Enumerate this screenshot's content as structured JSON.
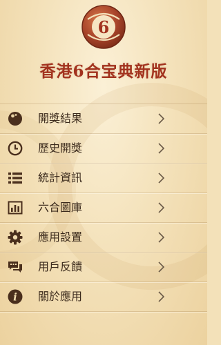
{
  "app": {
    "logo_icon": "lottery-ball-6-logo",
    "title": "香港6合宝典新版"
  },
  "colors": {
    "title": "#a2321e",
    "icon": "#4a2f1d",
    "background": "#f3e1b9"
  },
  "menu": {
    "items": [
      {
        "label": "開獎結果",
        "icon": "ball-icon"
      },
      {
        "label": "歷史開獎",
        "icon": "clock-icon"
      },
      {
        "label": "統計資訊",
        "icon": "list-icon"
      },
      {
        "label": "六合圖庫",
        "icon": "chart-icon"
      },
      {
        "label": "應用設置",
        "icon": "gear-icon"
      },
      {
        "label": "用戶反饋",
        "icon": "chat-icon"
      },
      {
        "label": "關於應用",
        "icon": "info-icon"
      }
    ]
  }
}
